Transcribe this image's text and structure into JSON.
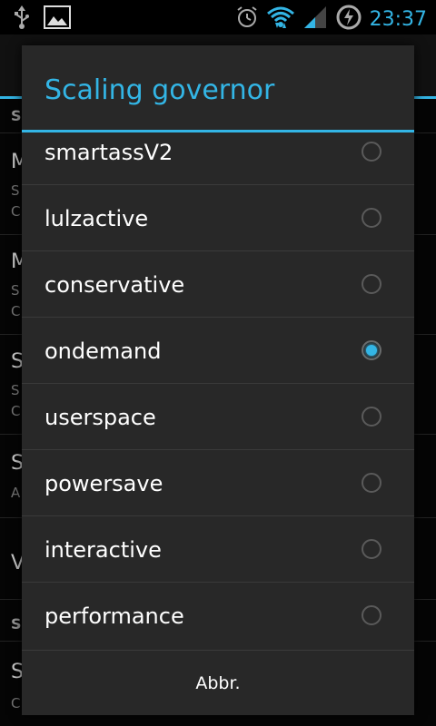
{
  "status_bar": {
    "time": "23:37",
    "icons": [
      "usb-icon",
      "image-icon",
      "alarm-icon",
      "wifi-icon",
      "signal-icon",
      "battery-charging-icon"
    ]
  },
  "background": {
    "items": [
      {
        "title": "S",
        "sub": ""
      },
      {
        "title": "M",
        "sub": "S"
      },
      {
        "title": "",
        "sub": "C"
      },
      {
        "title": "M",
        "sub": "S"
      },
      {
        "title": "",
        "sub": "C"
      },
      {
        "title": "S",
        "sub": "S"
      },
      {
        "title": "",
        "sub": "C"
      },
      {
        "title": "S",
        "sub": "A"
      },
      {
        "title": "V",
        "sub": ""
      },
      {
        "title": "S",
        "sub": ""
      },
      {
        "title": "S",
        "sub": "C"
      }
    ]
  },
  "dialog": {
    "title": "Scaling governor",
    "options": [
      {
        "label": "smartassV2",
        "checked": false
      },
      {
        "label": "lulzactive",
        "checked": false
      },
      {
        "label": "conservative",
        "checked": false
      },
      {
        "label": "ondemand",
        "checked": true
      },
      {
        "label": "userspace",
        "checked": false
      },
      {
        "label": "powersave",
        "checked": false
      },
      {
        "label": "interactive",
        "checked": false
      },
      {
        "label": "performance",
        "checked": false
      }
    ],
    "cancel_label": "Abbr."
  },
  "colors": {
    "accent": "#33b5e5",
    "dialog_bg": "#282828",
    "divider": "#3a3a3a"
  }
}
